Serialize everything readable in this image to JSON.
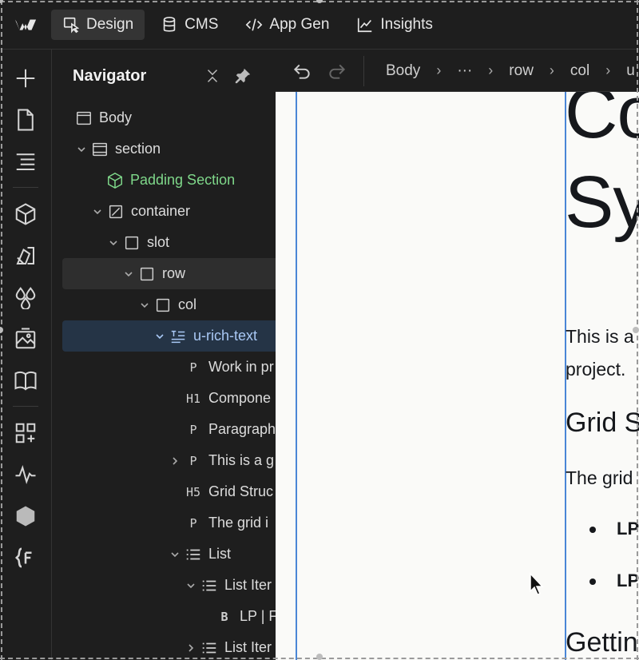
{
  "topbar": {
    "tabs": [
      {
        "label": "Design",
        "icon": "design-cursor-icon",
        "active": true
      },
      {
        "label": "CMS",
        "icon": "database-icon",
        "active": false
      },
      {
        "label": "App Gen",
        "icon": "code-icon",
        "active": false
      },
      {
        "label": "Insights",
        "icon": "chart-icon",
        "active": false
      }
    ]
  },
  "rail": {
    "icons": [
      "add-icon",
      "pages-icon",
      "navigator-icon",
      "components-icon",
      "style-selector-icon",
      "variables-icon",
      "assets-icon",
      "cms-book-icon",
      "apps-icon",
      "activity-icon",
      "box-icon",
      "code-braces-icon"
    ]
  },
  "navigator": {
    "title": "Navigator",
    "rows": [
      {
        "label": "Body",
        "icon": "body-icon"
      },
      {
        "label": "section",
        "icon": "section-icon"
      },
      {
        "label": "Padding Section",
        "icon": "component-icon"
      },
      {
        "label": "container",
        "icon": "container-icon"
      },
      {
        "label": "slot",
        "icon": "box-icon"
      },
      {
        "label": "row",
        "icon": "box-icon"
      },
      {
        "label": "col",
        "icon": "box-icon"
      },
      {
        "label": "u-rich-text",
        "icon": "rich-text-icon"
      },
      {
        "label": "Work in pr",
        "icon": "P"
      },
      {
        "label": "Compone",
        "icon": "H1"
      },
      {
        "label": "Paragraph",
        "icon": "P"
      },
      {
        "label": "This is a g",
        "icon": "P"
      },
      {
        "label": "Grid Struc",
        "icon": "H5"
      },
      {
        "label": "The grid i",
        "icon": "P"
      },
      {
        "label": "List",
        "icon": "list-icon"
      },
      {
        "label": "List Iter",
        "icon": "list-icon"
      },
      {
        "label": "LP | F",
        "icon": "B"
      },
      {
        "label": "List Iter",
        "icon": "list-icon"
      }
    ]
  },
  "breadcrumbs": [
    "Body",
    "···",
    "row",
    "col",
    "u"
  ],
  "canvas": {
    "heading_line1": "Co",
    "heading_line2": "Sy",
    "para_line1": "This is a",
    "para_line2": "project.",
    "h5": "Grid S",
    "grid_para": "The grid",
    "list_item1": "LP",
    "list_item2": "LP",
    "getting": "Gettin"
  },
  "colors": {
    "selection_blue": "#4a86d6",
    "component_green": "#7fd88a",
    "canvas_bg": "#fafaf8"
  }
}
